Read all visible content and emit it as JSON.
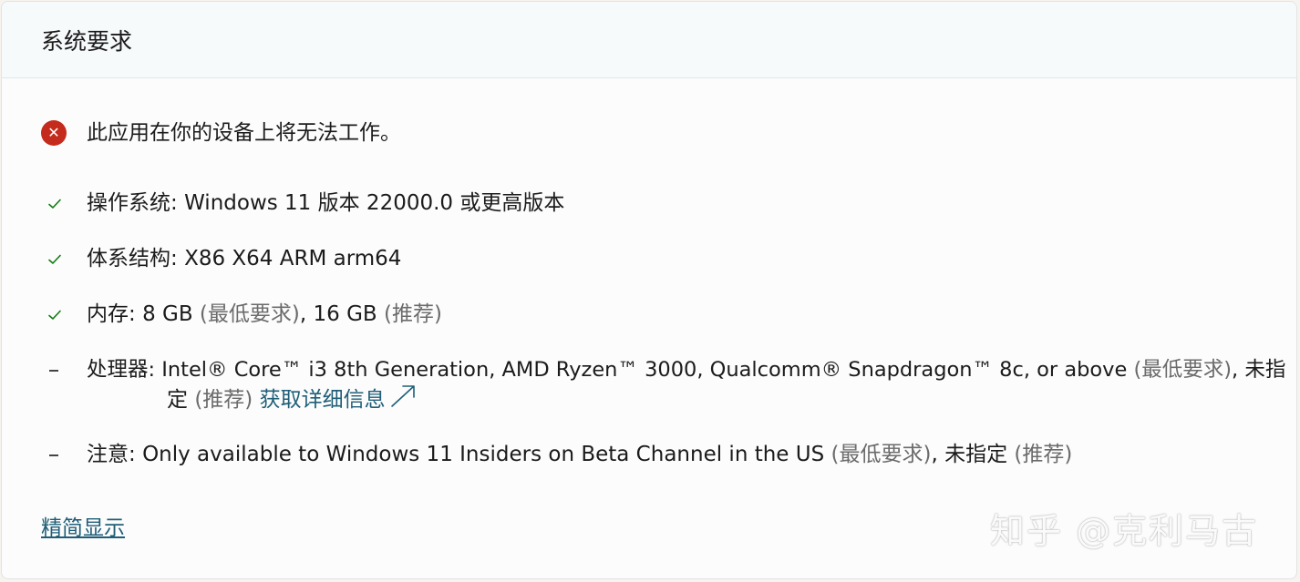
{
  "panel": {
    "title": "系统要求"
  },
  "status": {
    "icon": "error-circle-icon",
    "color": "#c42b1c",
    "message": "此应用在你的设备上将无法工作。"
  },
  "requirements": {
    "os": {
      "status_icon": "check-icon",
      "label": "操作系统: ",
      "value": "Windows 11 版本 22000.0 或更高版本"
    },
    "arch": {
      "status_icon": "check-icon",
      "label": "体系结构: ",
      "value": "X86 X64 ARM arm64"
    },
    "memory": {
      "status_icon": "check-icon",
      "label": "内存: ",
      "min_value": "8 GB",
      "min_tag": "(最低要求)",
      "sep": ", ",
      "rec_value": "16 GB",
      "rec_tag": "(推荐)"
    },
    "processor": {
      "status_icon": "dash-icon",
      "label": "处理器: ",
      "min_value": "Intel® Core™ i3 8th Generation, AMD Ryzen™ 3000, Qualcomm® Snapdragon™ 8c, or above",
      "min_tag": "(最低要求)",
      "sep": ", ",
      "rec_value_part1": "未指",
      "rec_value_part2": "定",
      "rec_tag": "(推荐)",
      "link_label": "获取详细信息"
    },
    "notes": {
      "status_icon": "dash-icon",
      "label": "注意: ",
      "min_value": "Only available to Windows 11 Insiders on Beta Channel in the US",
      "min_tag": "(最低要求)",
      "sep": ", ",
      "rec_value": "未指定",
      "rec_tag": "(推荐)"
    }
  },
  "footer": {
    "toggle_label": "精简显示"
  },
  "watermark": {
    "text": "知乎 @克利马古"
  },
  "colors": {
    "accent_link": "#1f5e77",
    "check_green": "#107c10",
    "error_red": "#c42b1c"
  }
}
